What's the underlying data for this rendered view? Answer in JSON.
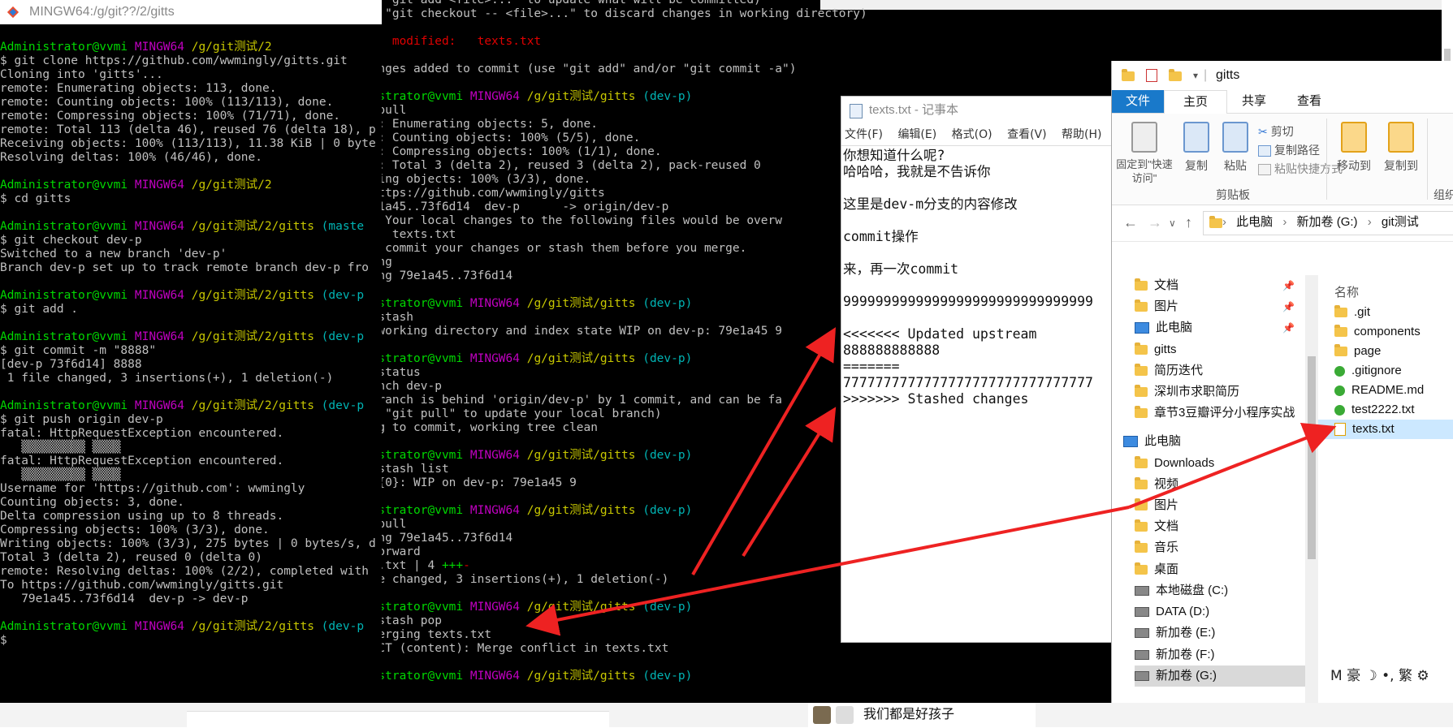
{
  "terminal_left": {
    "title": "MINGW64:/g/git??/2/gitts",
    "lines": [
      [
        {
          "t": "Administrator@vvmi ",
          "c": "g"
        },
        {
          "t": "MINGW64 ",
          "c": "m"
        },
        {
          "t": "/g/git测试/2",
          "c": "y"
        }
      ],
      [
        {
          "t": "$ git clone https://github.com/wwmingly/gitts.git",
          "c": "w"
        }
      ],
      [
        {
          "t": "Cloning into 'gitts'...",
          "c": "w"
        }
      ],
      [
        {
          "t": "remote: Enumerating objects: 113, done.",
          "c": "w"
        }
      ],
      [
        {
          "t": "remote: Counting objects: 100% (113/113), done.",
          "c": "w"
        }
      ],
      [
        {
          "t": "remote: Compressing objects: 100% (71/71), done.",
          "c": "w"
        }
      ],
      [
        {
          "t": "remote: Total 113 (delta 46), reused 76 (delta 18), p",
          "c": "w"
        }
      ],
      [
        {
          "t": "Receiving objects: 100% (113/113), 11.38 KiB | 0 byte",
          "c": "w"
        }
      ],
      [
        {
          "t": "Resolving deltas: 100% (46/46), done.",
          "c": "w"
        }
      ],
      [
        {
          "t": "",
          "c": "w"
        }
      ],
      [
        {
          "t": "Administrator@vvmi ",
          "c": "g"
        },
        {
          "t": "MINGW64 ",
          "c": "m"
        },
        {
          "t": "/g/git测试/2",
          "c": "y"
        }
      ],
      [
        {
          "t": "$ cd gitts",
          "c": "w"
        }
      ],
      [
        {
          "t": "",
          "c": "w"
        }
      ],
      [
        {
          "t": "Administrator@vvmi ",
          "c": "g"
        },
        {
          "t": "MINGW64 ",
          "c": "m"
        },
        {
          "t": "/g/git测试/2/gitts ",
          "c": "y"
        },
        {
          "t": "(maste",
          "c": "c"
        }
      ],
      [
        {
          "t": "$ git checkout dev-p",
          "c": "w"
        }
      ],
      [
        {
          "t": "Switched to a new branch 'dev-p'",
          "c": "w"
        }
      ],
      [
        {
          "t": "Branch dev-p set up to track remote branch dev-p fro",
          "c": "w"
        }
      ],
      [
        {
          "t": "",
          "c": "w"
        }
      ],
      [
        {
          "t": "Administrator@vvmi ",
          "c": "g"
        },
        {
          "t": "MINGW64 ",
          "c": "m"
        },
        {
          "t": "/g/git测试/2/gitts ",
          "c": "y"
        },
        {
          "t": "(dev-p",
          "c": "c"
        }
      ],
      [
        {
          "t": "$ git add .",
          "c": "w"
        }
      ],
      [
        {
          "t": "",
          "c": "w"
        }
      ],
      [
        {
          "t": "Administrator@vvmi ",
          "c": "g"
        },
        {
          "t": "MINGW64 ",
          "c": "m"
        },
        {
          "t": "/g/git测试/2/gitts ",
          "c": "y"
        },
        {
          "t": "(dev-p",
          "c": "c"
        }
      ],
      [
        {
          "t": "$ git commit -m \"8888\"",
          "c": "w"
        }
      ],
      [
        {
          "t": "[dev-p 73f6d14] 8888",
          "c": "w"
        }
      ],
      [
        {
          "t": " 1 file changed, 3 insertions(+), 1 deletion(-)",
          "c": "w"
        }
      ],
      [
        {
          "t": "",
          "c": "w"
        }
      ],
      [
        {
          "t": "Administrator@vvmi ",
          "c": "g"
        },
        {
          "t": "MINGW64 ",
          "c": "m"
        },
        {
          "t": "/g/git测试/2/gitts ",
          "c": "y"
        },
        {
          "t": "(dev-p",
          "c": "c"
        }
      ],
      [
        {
          "t": "$ git push origin dev-p",
          "c": "w"
        }
      ],
      [
        {
          "t": "fatal: HttpRequestException encountered.",
          "c": "w"
        }
      ],
      [
        {
          "t": "   ▒▒▒▒▒▒▒▒▒ ▒▒▒▒",
          "c": "w"
        }
      ],
      [
        {
          "t": "fatal: HttpRequestException encountered.",
          "c": "w"
        }
      ],
      [
        {
          "t": "   ▒▒▒▒▒▒▒▒▒ ▒▒▒▒",
          "c": "w"
        }
      ],
      [
        {
          "t": "Username for 'https://github.com': wwmingly",
          "c": "w"
        }
      ],
      [
        {
          "t": "Counting objects: 3, done.",
          "c": "w"
        }
      ],
      [
        {
          "t": "Delta compression using up to 8 threads.",
          "c": "w"
        }
      ],
      [
        {
          "t": "Compressing objects: 100% (3/3), done.",
          "c": "w"
        }
      ],
      [
        {
          "t": "Writing objects: 100% (3/3), 275 bytes | 0 bytes/s, d",
          "c": "w"
        }
      ],
      [
        {
          "t": "Total 3 (delta 2), reused 0 (delta 0)",
          "c": "w"
        }
      ],
      [
        {
          "t": "remote: Resolving deltas: 100% (2/2), completed with",
          "c": "w"
        }
      ],
      [
        {
          "t": "To https://github.com/wwmingly/gitts.git",
          "c": "w"
        }
      ],
      [
        {
          "t": "   79e1a45..73f6d14  dev-p -> dev-p",
          "c": "w"
        }
      ],
      [
        {
          "t": "",
          "c": "w"
        }
      ],
      [
        {
          "t": "Administrator@vvmi ",
          "c": "g"
        },
        {
          "t": "MINGW64 ",
          "c": "m"
        },
        {
          "t": "/g/git测试/2/gitts ",
          "c": "y"
        },
        {
          "t": "(dev-p",
          "c": "c"
        }
      ],
      [
        {
          "t": "$ ",
          "c": "w"
        }
      ]
    ]
  },
  "terminal_right": {
    "lines": [
      [
        {
          "t": "  (use \"git add <file>...\" to update what will be committed)",
          "c": "w"
        }
      ],
      [
        {
          "t": "  (use \"git checkout -- <file>...\" to discard changes in working directory)",
          "c": "w"
        }
      ],
      [
        {
          "t": "",
          "c": "w"
        }
      ],
      [
        {
          "t": "        modified:   texts.txt",
          "c": "r"
        }
      ],
      [
        {
          "t": "",
          "c": "w"
        }
      ],
      [
        {
          "t": "no changes added to commit (use \"git add\" and/or \"git commit -a\")",
          "c": "w"
        }
      ],
      [
        {
          "t": "",
          "c": "w"
        }
      ],
      [
        {
          "t": "Administrator@vvmi ",
          "c": "g"
        },
        {
          "t": "MINGW64 ",
          "c": "m"
        },
        {
          "t": "/g/git测试/gitts ",
          "c": "y"
        },
        {
          "t": "(dev-p)",
          "c": "c"
        }
      ],
      [
        {
          "t": "$ git pull",
          "c": "w"
        }
      ],
      [
        {
          "t": "remote: Enumerating objects: 5, done.",
          "c": "w"
        }
      ],
      [
        {
          "t": "remote: Counting objects: 100% (5/5), done.",
          "c": "w"
        }
      ],
      [
        {
          "t": "remote: Compressing objects: 100% (1/1), done.",
          "c": "w"
        }
      ],
      [
        {
          "t": "remote: Total 3 (delta 2), reused 3 (delta 2), pack-reused 0",
          "c": "w"
        }
      ],
      [
        {
          "t": "Unpacking objects: 100% (3/3), done.",
          "c": "w"
        }
      ],
      [
        {
          "t": "From https://github.com/wwmingly/gitts",
          "c": "w"
        }
      ],
      [
        {
          "t": "   79e1a45..73f6d14  dev-p      -> origin/dev-p",
          "c": "w"
        }
      ],
      [
        {
          "t": "error: Your local changes to the following files would be overw",
          "c": "w"
        }
      ],
      [
        {
          "t": "        texts.txt",
          "c": "w"
        }
      ],
      [
        {
          "t": "Please commit your changes or stash them before you merge.",
          "c": "w"
        }
      ],
      [
        {
          "t": "Aborting",
          "c": "w"
        }
      ],
      [
        {
          "t": "Updating 79e1a45..73f6d14",
          "c": "w"
        }
      ],
      [
        {
          "t": "",
          "c": "w"
        }
      ],
      [
        {
          "t": "Administrator@vvmi ",
          "c": "g"
        },
        {
          "t": "MINGW64 ",
          "c": "m"
        },
        {
          "t": "/g/git测试/gitts ",
          "c": "y"
        },
        {
          "t": "(dev-p)",
          "c": "c"
        }
      ],
      [
        {
          "t": "$ git stash",
          "c": "w"
        }
      ],
      [
        {
          "t": "Saved working directory and index state WIP on dev-p: 79e1a45 9",
          "c": "w"
        }
      ],
      [
        {
          "t": "",
          "c": "w"
        }
      ],
      [
        {
          "t": "Administrator@vvmi ",
          "c": "g"
        },
        {
          "t": "MINGW64 ",
          "c": "m"
        },
        {
          "t": "/g/git测试/gitts ",
          "c": "y"
        },
        {
          "t": "(dev-p)",
          "c": "c"
        }
      ],
      [
        {
          "t": "$ git status",
          "c": "w"
        }
      ],
      [
        {
          "t": "On branch dev-p",
          "c": "w"
        }
      ],
      [
        {
          "t": "Your branch is behind 'origin/dev-p' by 1 commit, and can be fa",
          "c": "w"
        }
      ],
      [
        {
          "t": "  (use \"git pull\" to update your local branch)",
          "c": "w"
        }
      ],
      [
        {
          "t": "nothing to commit, working tree clean",
          "c": "w"
        }
      ],
      [
        {
          "t": "",
          "c": "w"
        }
      ],
      [
        {
          "t": "Administrator@vvmi ",
          "c": "g"
        },
        {
          "t": "MINGW64 ",
          "c": "m"
        },
        {
          "t": "/g/git测试/gitts ",
          "c": "y"
        },
        {
          "t": "(dev-p)",
          "c": "c"
        }
      ],
      [
        {
          "t": "$ git stash list",
          "c": "w"
        }
      ],
      [
        {
          "t": "stash@{0}: WIP on dev-p: 79e1a45 9",
          "c": "w"
        }
      ],
      [
        {
          "t": "",
          "c": "w"
        }
      ],
      [
        {
          "t": "Administrator@vvmi ",
          "c": "g"
        },
        {
          "t": "MINGW64 ",
          "c": "m"
        },
        {
          "t": "/g/git测试/gitts ",
          "c": "y"
        },
        {
          "t": "(dev-p)",
          "c": "c"
        }
      ],
      [
        {
          "t": "$ git pull",
          "c": "w"
        }
      ],
      [
        {
          "t": "Updating 79e1a45..73f6d14",
          "c": "w"
        }
      ],
      [
        {
          "t": "Fast-forward",
          "c": "w"
        }
      ],
      [
        {
          "t": " texts.txt | 4 ",
          "c": "w"
        },
        {
          "t": "+++",
          "c": "g"
        },
        {
          "t": "-",
          "c": "r"
        }
      ],
      [
        {
          "t": " 1 file changed, 3 insertions(+), 1 deletion(-)",
          "c": "w"
        }
      ],
      [
        {
          "t": "",
          "c": "w"
        }
      ],
      [
        {
          "t": "Administrator@vvmi ",
          "c": "g"
        },
        {
          "t": "MINGW64 ",
          "c": "m"
        },
        {
          "t": "/g/git测试/gitts ",
          "c": "y"
        },
        {
          "t": "(dev-p)",
          "c": "c"
        }
      ],
      [
        {
          "t": "$ git stash pop",
          "c": "w"
        }
      ],
      [
        {
          "t": "Auto-merging texts.txt",
          "c": "w"
        }
      ],
      [
        {
          "t": "CONFLICT (content): Merge conflict in texts.txt",
          "c": "w"
        }
      ],
      [
        {
          "t": "",
          "c": "w"
        }
      ],
      [
        {
          "t": "Administrator@vvmi ",
          "c": "g"
        },
        {
          "t": "MINGW64 ",
          "c": "m"
        },
        {
          "t": "/g/git测试/gitts ",
          "c": "y"
        },
        {
          "t": "(dev-p)",
          "c": "c"
        }
      ],
      [
        {
          "t": "$ ",
          "c": "w"
        }
      ]
    ]
  },
  "notepad": {
    "title": "texts.txt - 记事本",
    "menu": [
      "文件(F)",
      "编辑(E)",
      "格式(O)",
      "查看(V)",
      "帮助(H)"
    ],
    "lines": [
      "你想知道什么呢?",
      "哈哈哈，我就是不告诉你",
      "",
      "这里是dev-m分支的内容修改",
      "",
      "commit操作",
      "",
      "来，再一次commit",
      "",
      "9999999999999999999999999999999",
      "",
      "<<<<<<< Updated upstream",
      "888888888888",
      "=======",
      "7777777777777777777777777777777",
      ">>>>>>> Stashed changes"
    ]
  },
  "explorer": {
    "title": "gitts",
    "tabs": [
      "文件",
      "主页",
      "共享",
      "查看"
    ],
    "ribbon": {
      "pin": "固定到\"快速访问\"",
      "copy": "复制",
      "paste": "粘贴",
      "cut": "剪切",
      "copy_path": "复制路径",
      "paste_shortcut": "粘贴快捷方式",
      "group": "剪贴板",
      "move_to": "移动到",
      "copy_to": "复制到",
      "group2": "组织"
    },
    "breadcrumb": [
      "此电脑",
      "新加卷 (G:)",
      "git测试"
    ],
    "nav": [
      {
        "label": "文档",
        "pinned": true
      },
      {
        "label": "图片",
        "pinned": true
      },
      {
        "label": "此电脑",
        "pinned": true
      },
      {
        "label": "gitts",
        "pinned": false
      },
      {
        "label": "简历迭代",
        "pinned": false
      },
      {
        "label": "深圳市求职简历",
        "pinned": false
      },
      {
        "label": "章节3豆瓣评分小程序实战",
        "pinned": false
      },
      {
        "label": "此电脑",
        "pinned": false
      },
      {
        "label": "Downloads",
        "pinned": false
      },
      {
        "label": "视频",
        "pinned": false
      },
      {
        "label": "图片",
        "pinned": false
      },
      {
        "label": "文档",
        "pinned": false
      },
      {
        "label": "音乐",
        "pinned": false
      },
      {
        "label": "桌面",
        "pinned": false
      },
      {
        "label": "本地磁盘 (C:)",
        "pinned": false
      },
      {
        "label": "DATA (D:)",
        "pinned": false
      },
      {
        "label": "新加卷 (E:)",
        "pinned": false
      },
      {
        "label": "新加卷 (F:)",
        "pinned": false
      },
      {
        "label": "新加卷 (G:)",
        "pinned": false
      }
    ],
    "column_header": "名称",
    "files": [
      ".git",
      "components",
      "page",
      ".gitignore",
      "README.md",
      "test2222.txt",
      "texts.txt"
    ],
    "ime": "M 豪 ☽ •, 繁 ⚙"
  },
  "taskbar": {
    "item": "我们都是好孩子"
  },
  "colors": {
    "prompt_green": "#00d800",
    "mingw_magenta": "#c000c0",
    "path_yellow": "#c8c800",
    "branch_cyan": "#00b4b4",
    "arrow_red": "#ee2222",
    "explorer_tab_blue": "#1979ca"
  }
}
